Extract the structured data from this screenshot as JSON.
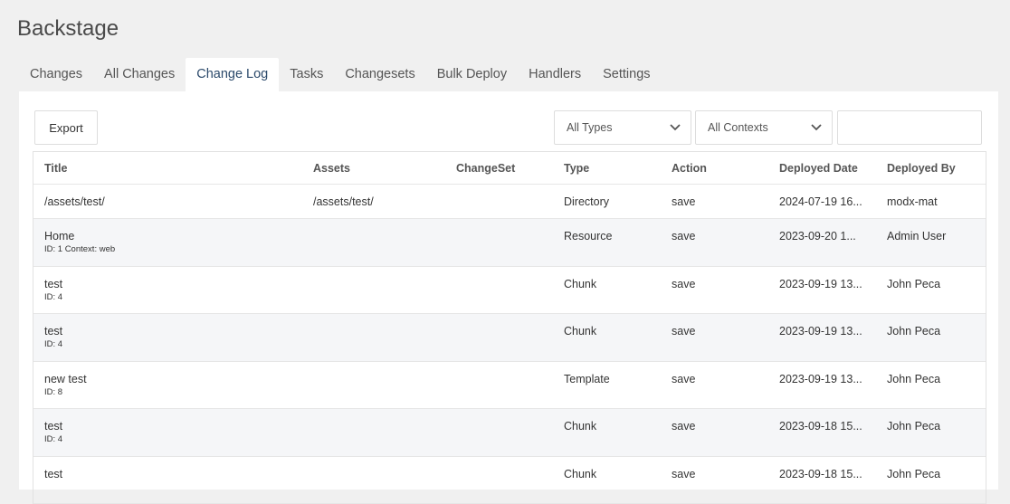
{
  "app": {
    "title": "Backstage"
  },
  "tabs": [
    {
      "label": "Changes",
      "active": false
    },
    {
      "label": "All Changes",
      "active": false
    },
    {
      "label": "Change Log",
      "active": true
    },
    {
      "label": "Tasks",
      "active": false
    },
    {
      "label": "Changesets",
      "active": false
    },
    {
      "label": "Bulk Deploy",
      "active": false
    },
    {
      "label": "Handlers",
      "active": false
    },
    {
      "label": "Settings",
      "active": false
    }
  ],
  "toolbar": {
    "export_label": "Export",
    "type_filter": "All Types",
    "context_filter": "All Contexts",
    "search_value": ""
  },
  "table": {
    "columns": [
      "Title",
      "Assets",
      "ChangeSet",
      "Type",
      "Action",
      "Deployed Date",
      "Deployed By"
    ],
    "rows": [
      {
        "title": "/assets/test/",
        "sub": "",
        "assets": "/assets/test/",
        "changeset": "",
        "type": "Directory",
        "action": "save",
        "date": "2024-07-19 16...",
        "by": "modx-mat"
      },
      {
        "title": "Home",
        "sub": "ID: 1 Context: web",
        "assets": "",
        "changeset": "",
        "type": "Resource",
        "action": "save",
        "date": "2023-09-20 1...",
        "by": "Admin User"
      },
      {
        "title": "test",
        "sub": "ID: 4",
        "assets": "",
        "changeset": "",
        "type": "Chunk",
        "action": "save",
        "date": "2023-09-19 13...",
        "by": "John Peca"
      },
      {
        "title": "test",
        "sub": "ID: 4",
        "assets": "",
        "changeset": "",
        "type": "Chunk",
        "action": "save",
        "date": "2023-09-19 13...",
        "by": "John Peca"
      },
      {
        "title": "new test",
        "sub": "ID: 8",
        "assets": "",
        "changeset": "",
        "type": "Template",
        "action": "save",
        "date": "2023-09-19 13...",
        "by": "John Peca"
      },
      {
        "title": "test",
        "sub": "ID: 4",
        "assets": "",
        "changeset": "",
        "type": "Chunk",
        "action": "save",
        "date": "2023-09-18 15...",
        "by": "John Peca"
      },
      {
        "title": "test",
        "sub": "",
        "assets": "",
        "changeset": "",
        "type": "Chunk",
        "action": "save",
        "date": "2023-09-18 15...",
        "by": "John Peca"
      }
    ]
  },
  "icons": {
    "dropdown": "chevron-down-icon"
  },
  "colors": {
    "active_tab_text": "#2c4a6b",
    "alt_row": "#f5f6f8",
    "page_bg": "#f0f0f0"
  }
}
